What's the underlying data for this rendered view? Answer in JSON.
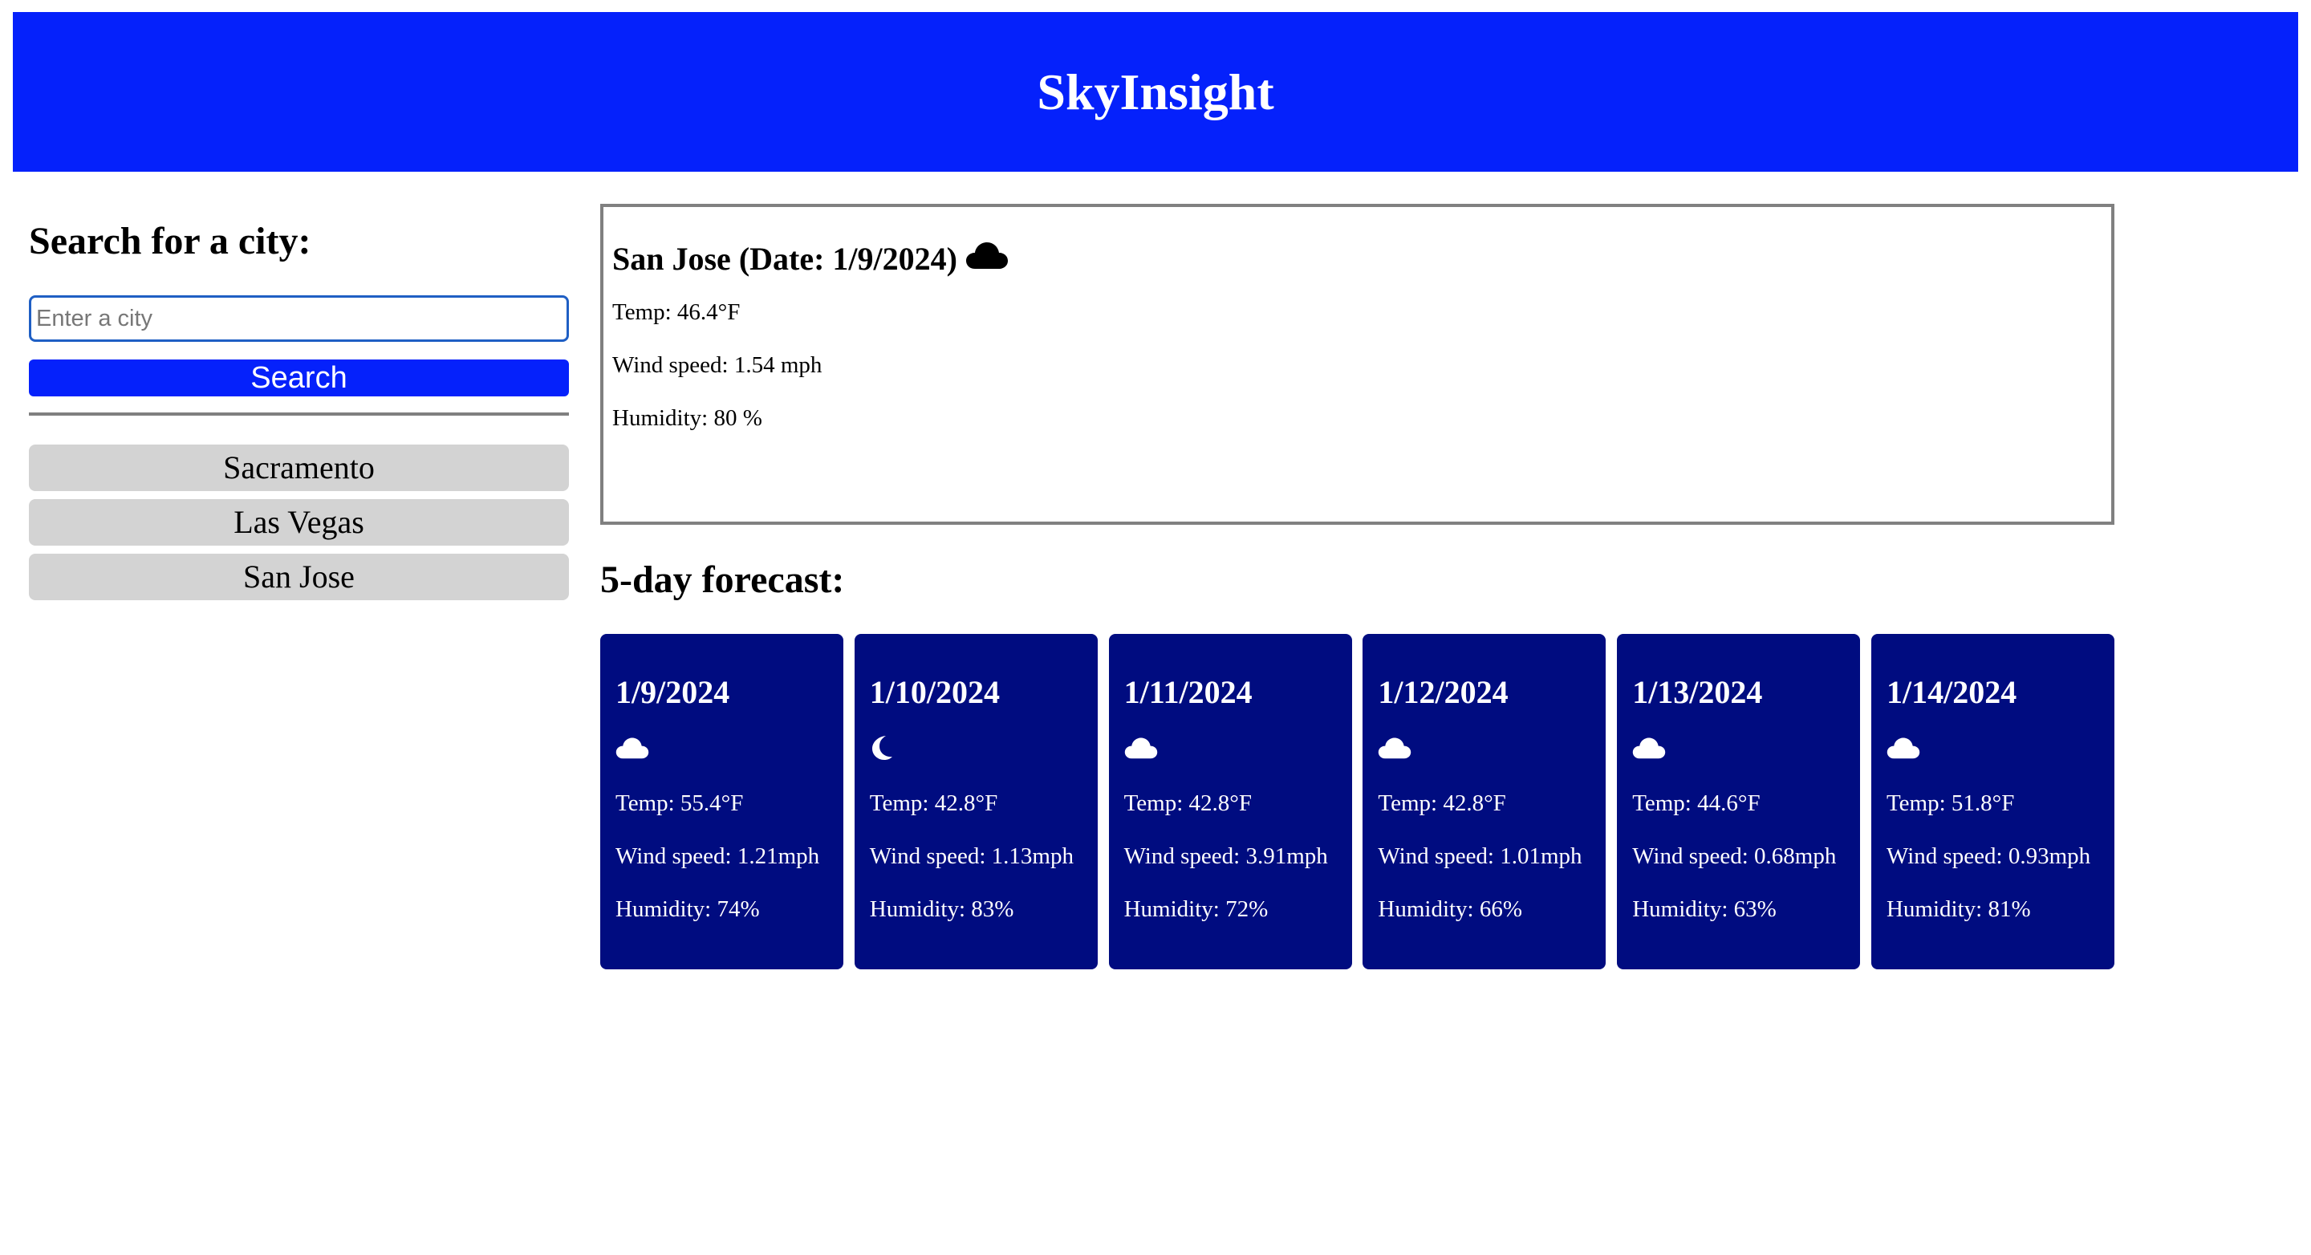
{
  "header": {
    "title": "SkyInsight"
  },
  "search": {
    "heading": "Search for a city:",
    "placeholder": "Enter a city",
    "value": "",
    "button_label": "Search"
  },
  "history": [
    {
      "label": "Sacramento"
    },
    {
      "label": "Las Vegas"
    },
    {
      "label": "San Jose"
    }
  ],
  "current": {
    "title": "San Jose (Date: 1/9/2024)",
    "icon": "cloud-icon",
    "temp": "Temp: 46.4°F",
    "wind": "Wind speed: 1.54 mph",
    "humidity": "Humidity: 80 %"
  },
  "forecast": {
    "heading": "5-day forecast:",
    "days": [
      {
        "date": "1/9/2024",
        "icon": "cloud-icon",
        "temp": "Temp: 55.4°F",
        "wind": "Wind speed: 1.21mph",
        "humidity": "Humidity: 74%"
      },
      {
        "date": "1/10/2024",
        "icon": "moon-icon",
        "temp": "Temp: 42.8°F",
        "wind": "Wind speed: 1.13mph",
        "humidity": "Humidity: 83%"
      },
      {
        "date": "1/11/2024",
        "icon": "cloud-icon",
        "temp": "Temp: 42.8°F",
        "wind": "Wind speed: 3.91mph",
        "humidity": "Humidity: 72%"
      },
      {
        "date": "1/12/2024",
        "icon": "cloud-icon",
        "temp": "Temp: 42.8°F",
        "wind": "Wind speed: 1.01mph",
        "humidity": "Humidity: 66%"
      },
      {
        "date": "1/13/2024",
        "icon": "cloud-icon",
        "temp": "Temp: 44.6°F",
        "wind": "Wind speed: 0.68mph",
        "humidity": "Humidity: 63%"
      },
      {
        "date": "1/14/2024",
        "icon": "cloud-icon",
        "temp": "Temp: 51.8°F",
        "wind": "Wind speed: 0.93mph",
        "humidity": "Humidity: 81%"
      }
    ]
  },
  "colors": {
    "header_bg": "#0521fb",
    "search_button_bg": "#0521fb",
    "card_bg": "#000c80",
    "history_button_bg": "#d3d3d3",
    "border_gray": "#808080"
  }
}
